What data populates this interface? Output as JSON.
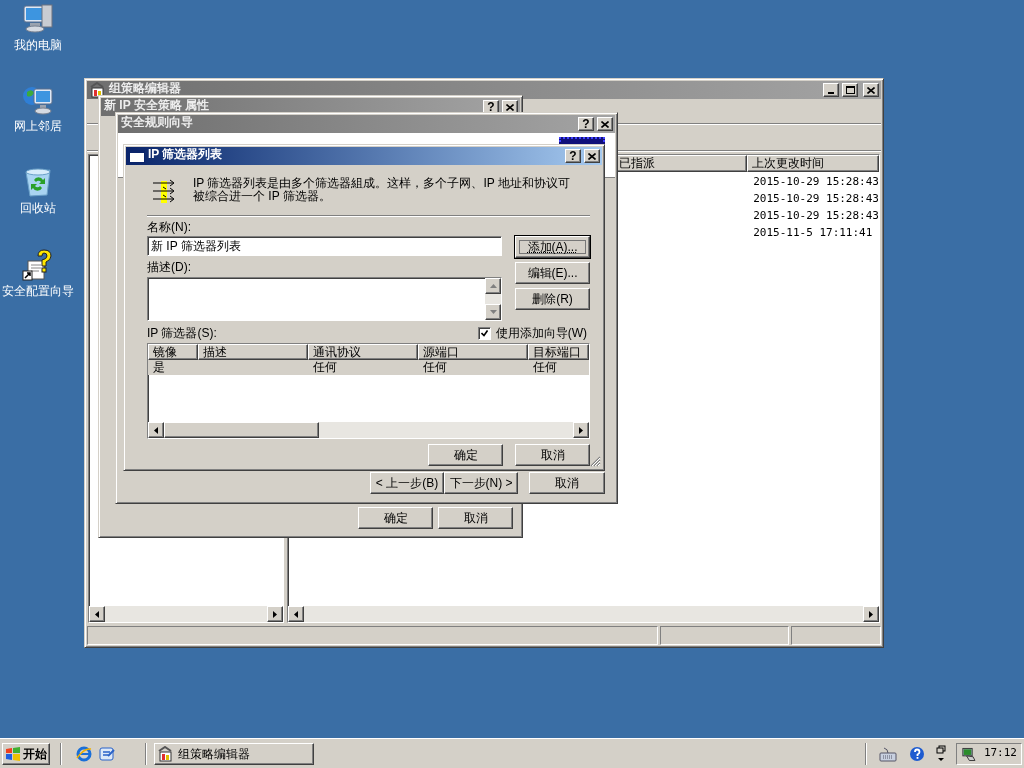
{
  "desktop_icons": [
    {
      "kind": "computer",
      "label": "我的电脑"
    },
    {
      "kind": "network",
      "label": "网上邻居"
    },
    {
      "kind": "recycle",
      "label": "回收站"
    },
    {
      "kind": "wizard",
      "label": "安全配置向导"
    }
  ],
  "main_window": {
    "title": "组策略编辑器",
    "active": false,
    "list": {
      "columns": [
        "已指派",
        "上次更改时间"
      ],
      "rows": [
        {
          "modified": "2015-10-29 15:28:43"
        },
        {
          "modified": "2015-10-29 15:28:43"
        },
        {
          "modified": "2015-10-29 15:28:43"
        },
        {
          "modified": "2015-11-5 17:11:41"
        }
      ]
    }
  },
  "properties_dialog": {
    "title": "新 IP 安全策略 属性",
    "active": false,
    "help": "?",
    "buttons": [
      "确定",
      "取消"
    ]
  },
  "wizard": {
    "title": "安全规则向导",
    "active": false,
    "help": "?",
    "buttons": [
      "< 上一步(B)",
      "下一步(N) >",
      "取消"
    ]
  },
  "filter_list_dialog": {
    "title": "IP 筛选器列表",
    "active": true,
    "help": "?",
    "description": "IP 筛选器列表是由多个筛选器組成。这样，多个子网、IP 地址和协议可被综合进一个 IP 筛选器。",
    "name_label": "名称(N):",
    "name_value": "新 IP 筛选器列表",
    "description_label": "描述(D):",
    "side_buttons": [
      {
        "label": "添加(A)...",
        "focused": true
      },
      {
        "label": "编辑(E)...",
        "focused": false
      },
      {
        "label": "删除(R)",
        "focused": false
      }
    ],
    "filters_label": "IP 筛选器(S):",
    "use_wizard": {
      "label": "使用添加向导(W)",
      "checked": true
    },
    "table": {
      "columns": [
        "镜像",
        "描述",
        "通讯协议",
        "源端口",
        "目标端口"
      ],
      "rows": [
        {
          "mirrored": "是",
          "protocol": "任何",
          "source_port": "任何",
          "destination_port": "任何",
          "selected": true
        }
      ]
    },
    "buttons": [
      "确定",
      "取消"
    ]
  },
  "taskbar": {
    "start": "开始",
    "tasks": [
      {
        "label": "组策略编辑器",
        "selected": false
      }
    ],
    "clock": "17:12"
  }
}
